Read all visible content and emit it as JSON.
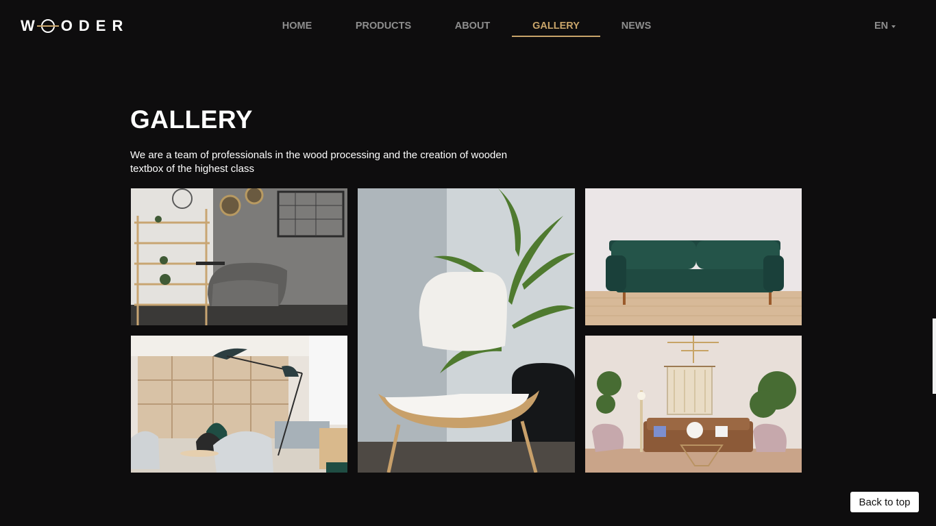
{
  "brand": {
    "logo_text": "WOODER"
  },
  "nav": {
    "items": [
      {
        "label": "HOME",
        "active": false
      },
      {
        "label": "PRODUCTS",
        "active": false
      },
      {
        "label": "ABOUT",
        "active": false
      },
      {
        "label": "GALLERY",
        "active": true
      },
      {
        "label": "NEWS",
        "active": false
      }
    ],
    "language": "EN"
  },
  "gallery": {
    "title": "GALLERY",
    "intro": "We are a team of professionals in the wood processing and the creation of wooden textbox of the highest class",
    "images": [
      {
        "subject": "shelves-and-grey-armchair"
      },
      {
        "subject": "office-lounge-with-lamp"
      },
      {
        "subject": "white-chair-and-palm"
      },
      {
        "subject": "green-velvet-sofa"
      },
      {
        "subject": "living-room-with-brown-sofa"
      }
    ]
  },
  "back_to_top_label": "Back to top",
  "colors": {
    "background": "#0e0d0e",
    "accent": "#c9a56a",
    "nav_text": "#8e8e8e"
  }
}
